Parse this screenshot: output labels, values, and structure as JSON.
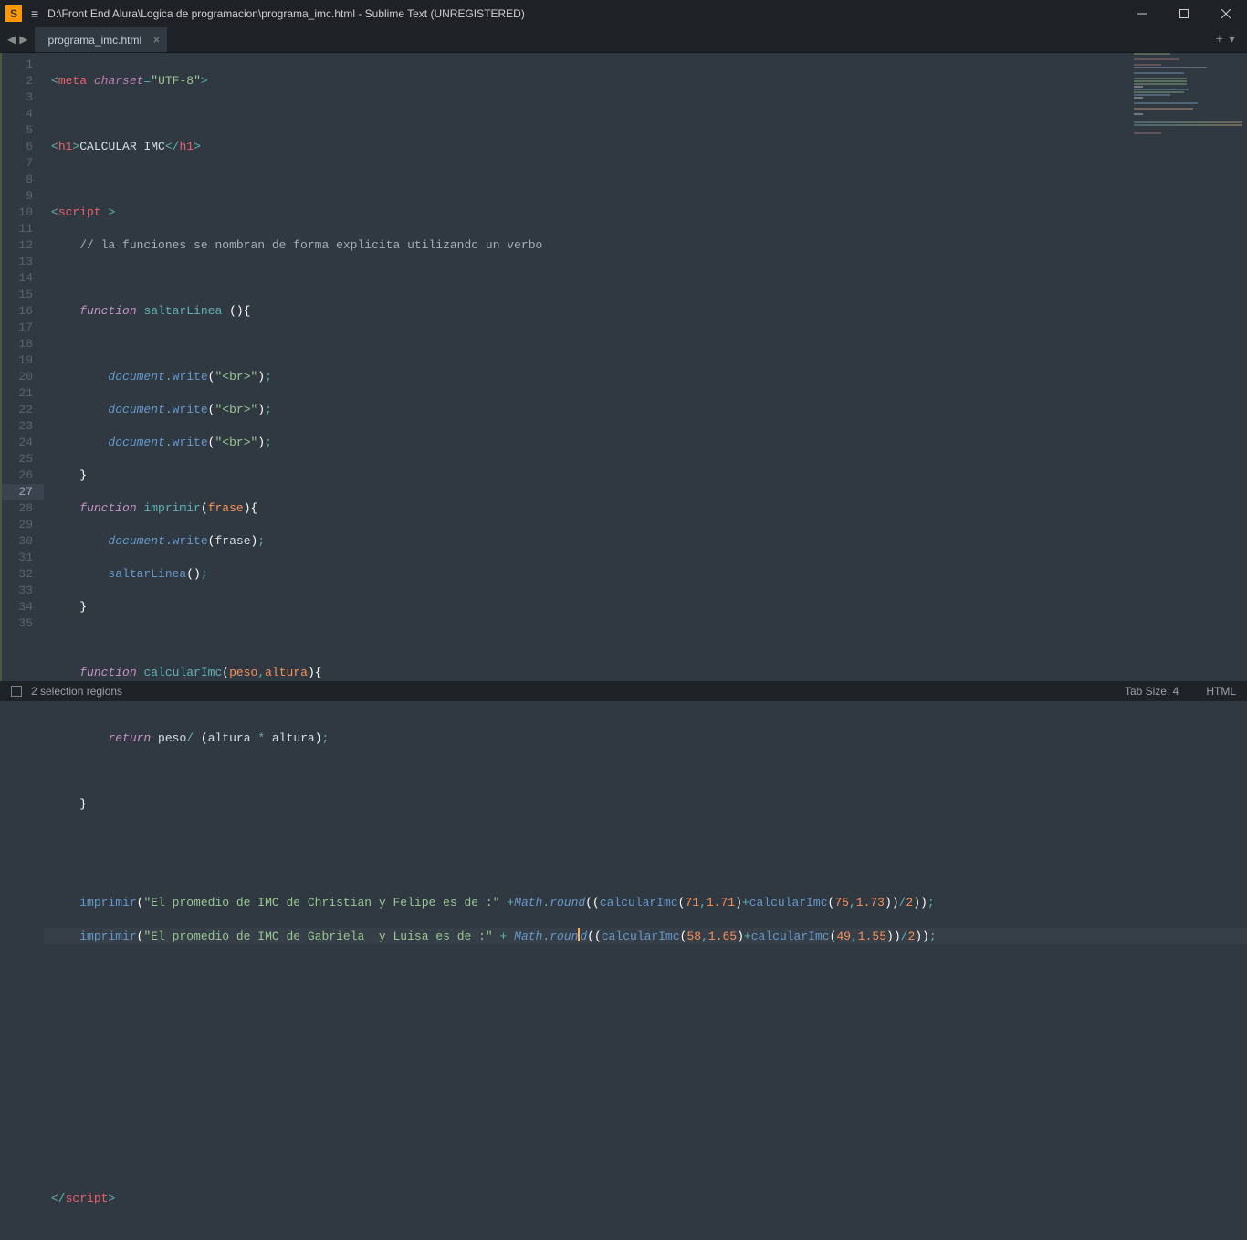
{
  "window": {
    "title": "D:\\Front End Alura\\Logica de programacion\\programa_imc.html - Sublime Text (UNREGISTERED)"
  },
  "tab": {
    "label": "programa_imc.html"
  },
  "status": {
    "left": "2 selection regions",
    "tabsize": "Tab Size: 4",
    "syntax": "HTML"
  },
  "code": {
    "heading_text": "CALCULAR IMC",
    "comment": "// la funciones se nombran de forma explicita utilizando un verbo",
    "fn_saltar": "saltarLinea",
    "fn_imprimir": "imprimir",
    "fn_calc": "calcularImc",
    "param_frase": "frase",
    "param_peso": "peso",
    "param_altura": "altura",
    "br": "\"<br>\"",
    "line26_str": "\"El promedio de IMC de Christian y Felipe es de :\"",
    "line27_str": "\"El promedio de IMC de Gabriela  y Luisa es de :\"",
    "n71": "71",
    "n171": "1.71",
    "n75": "75",
    "n173": "1.73",
    "n58": "58",
    "n165": "1.65",
    "n49": "49",
    "n155": "1.55",
    "n2": "2"
  },
  "line_count": 35
}
